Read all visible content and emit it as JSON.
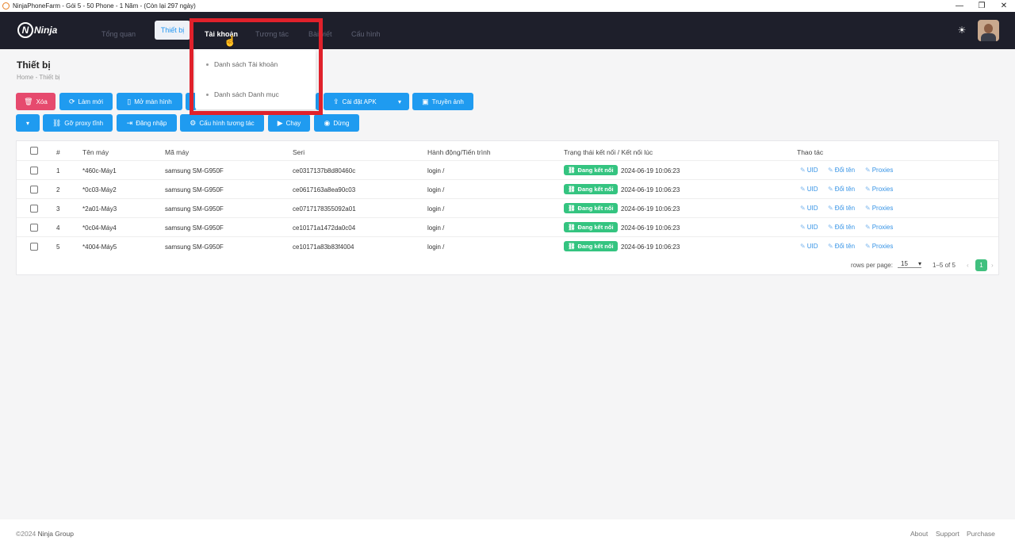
{
  "window": {
    "title": "NinjaPhoneFarm - Gói 5 - 50 Phone - 1 Năm - (Còn lại 297 ngày)",
    "controls": [
      "—",
      "❐",
      "✕"
    ]
  },
  "navbar": {
    "logo_text": "Ninja",
    "items": [
      "Tổng quan",
      "Thiết bị",
      "Tài khoản",
      "Tương tác",
      "Bài viết",
      "Cấu hình"
    ],
    "active": "Thiết bị",
    "open": "Tài khoản"
  },
  "dropdown": {
    "items": [
      "Danh sách Tài khoản",
      "Danh sách Danh mục"
    ]
  },
  "page": {
    "title": "Thiết bị",
    "breadcrumb": [
      "Home",
      "Thiết bị"
    ]
  },
  "toolbar": {
    "row1": [
      "Xóa",
      "Làm mới",
      "Mở màn hình",
      "Cài đặt APK",
      "Truyền ảnh"
    ],
    "row2": [
      "Gỡ proxy tĩnh",
      "Đăng nhập",
      "Cấu hình tương tác",
      "Chạy",
      "Dừng"
    ]
  },
  "table": {
    "headers": [
      "#",
      "Tên máy",
      "Mã máy",
      "Seri",
      "Hành động/Tiến trình",
      "Trạng thái kết nối / Kết nối lúc",
      "Thao tác"
    ],
    "rows": [
      {
        "n": "1",
        "name": "*460c-Máy1",
        "model": "samsung SM-G950F",
        "seri": "ce0317137b8d80460c",
        "action": "login /",
        "status": "Đang kết nối",
        "time": "2024-06-19 10:06:23"
      },
      {
        "n": "2",
        "name": "*0c03-Máy2",
        "model": "samsung SM-G950F",
        "seri": "ce0617163a8ea90c03",
        "action": "login /",
        "status": "Đang kết nối",
        "time": "2024-06-19 10:06:23"
      },
      {
        "n": "3",
        "name": "*2a01-Máy3",
        "model": "samsung SM-G950F",
        "seri": "ce0717178355092a01",
        "action": "login /",
        "status": "Đang kết nối",
        "time": "2024-06-19 10:06:23"
      },
      {
        "n": "4",
        "name": "*0c04-Máy4",
        "model": "samsung SM-G950F",
        "seri": "ce10171a1472da0c04",
        "action": "login /",
        "status": "Đang kết nối",
        "time": "2024-06-19 10:06:23"
      },
      {
        "n": "5",
        "name": "*4004-Máy5",
        "model": "samsung SM-G950F",
        "seri": "ce10171a83b83f4004",
        "action": "login /",
        "status": "Đang kết nối",
        "time": "2024-06-19 10:06:23"
      }
    ],
    "row_actions": [
      "UID",
      "Đổi tên",
      "Proxies"
    ]
  },
  "pagination": {
    "rows_label": "rows per page:",
    "rows_value": "15",
    "range": "1–5 of 5",
    "page": "1"
  },
  "footer": {
    "copyright": "©2024",
    "company": "Ninja Group",
    "links": [
      "About",
      "Support",
      "Purchase"
    ]
  },
  "colors": {
    "navbar": "#1e1f2b",
    "primary": "#1f9bf0",
    "danger": "#e64a6e",
    "success": "#34c480",
    "highlight": "#e0212b"
  }
}
